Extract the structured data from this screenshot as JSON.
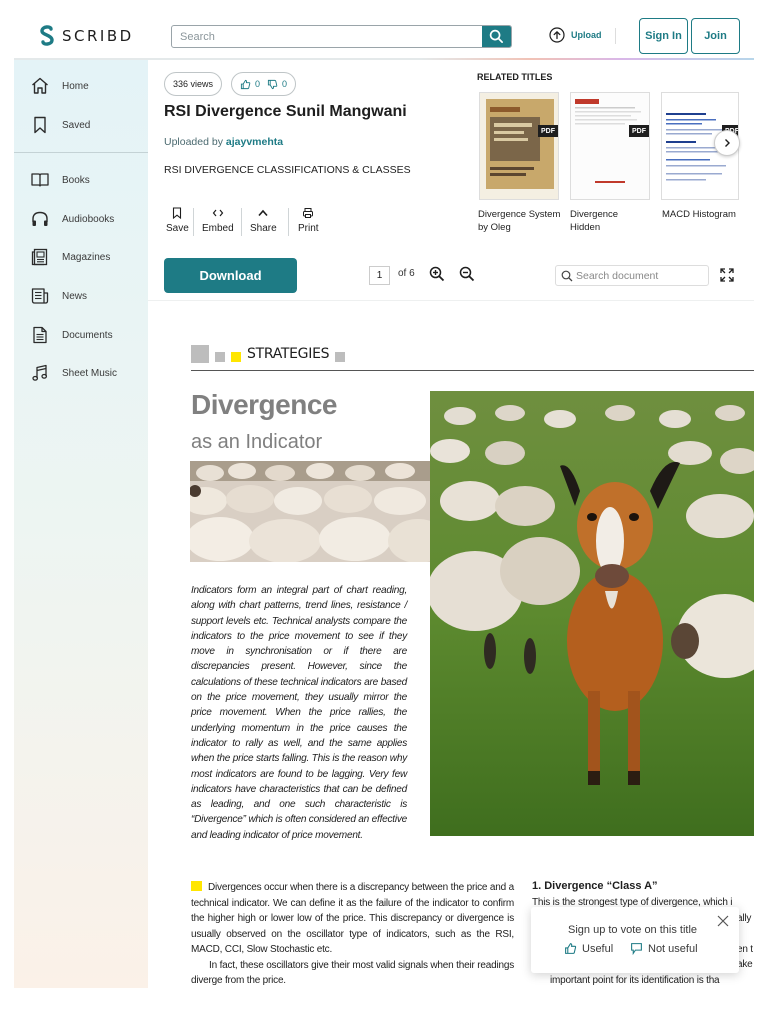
{
  "header": {
    "logo_text": "SCRIBD",
    "search_placeholder": "Search",
    "upload_label": "Upload",
    "signin_label": "Sign In",
    "join_label": "Join"
  },
  "sidebar": {
    "items": [
      {
        "label": "Home",
        "icon": "home-icon"
      },
      {
        "label": "Saved",
        "icon": "bookmark-icon"
      },
      {
        "label": "Books",
        "icon": "book-icon"
      },
      {
        "label": "Audiobooks",
        "icon": "headphones-icon"
      },
      {
        "label": "Magazines",
        "icon": "magazine-icon"
      },
      {
        "label": "News",
        "icon": "news-icon"
      },
      {
        "label": "Documents",
        "icon": "document-icon"
      },
      {
        "label": "Sheet Music",
        "icon": "music-note-icon"
      }
    ]
  },
  "doc": {
    "views": "336 views",
    "upvotes": "0",
    "downvotes": "0",
    "title": "RSI Divergence Sunil Mangwani",
    "uploaded_prefix": "Uploaded by",
    "uploader": "ajayvmehta",
    "description": "RSI DIVERGENCE CLASSIFICATIONS & CLASSES",
    "actions": {
      "save": "Save",
      "embed": "Embed",
      "share": "Share",
      "print": "Print"
    },
    "download_label": "Download",
    "current_page": "1",
    "page_total": "of 6",
    "search_placeholder": "Search document"
  },
  "related": {
    "heading": "RELATED TITLES",
    "items": [
      {
        "label": "Divergence System by Oleg",
        "badge": "PDF"
      },
      {
        "label": "Divergence Hidden",
        "badge": "PDF"
      },
      {
        "label": "MACD Histogram",
        "badge": "PDF"
      }
    ]
  },
  "page": {
    "section_label": "STRATEGIES",
    "article_title": "Divergence",
    "article_subtitle": "as an Indicator",
    "intro": "Indicators form an integral part of chart reading, along with chart patterns, trend lines, resistance / support levels etc. Technical analysts compare the indicators to the price movement to see if they move in synchronisation or if there are discrepancies present. However, since the calculations of these technical indicators are based on the price movement, they usually mirror the price movement. When the price rallies, the underlying momentum in the price causes the indicator to rally as well, and the same applies when the price starts falling. This is the reason why most indicators are found to be lagging. Very few indicators have characteristics that can be defined as leading, and one such characteristic is “Divergence” which is often considered an effective and leading indicator of price movement.",
    "col_left_p1": "Divergences occur when there is a discrepancy between the price and a technical indicator. We can define it as the failure of the indicator to confirm the higher high or lower low of the price. This discrepancy or divergence is usually observed on the oscillator type of indicators, such as the RSI, MACD, CCI, Slow Stochastic etc.",
    "col_left_p2": "In fact, these oscillators give their most valid signals when their readings diverge from the price.",
    "col_right_title": "1. Divergence “Class A”",
    "col_right_lines": [
      "This is the strongest type of divergence, which i",
      "ally",
      "",
      "en t",
      "ake",
      "important point for its identification is tha"
    ]
  },
  "vote_popup": {
    "title": "Sign up to vote on this title",
    "useful": "Useful",
    "not_useful": "Not useful"
  }
}
